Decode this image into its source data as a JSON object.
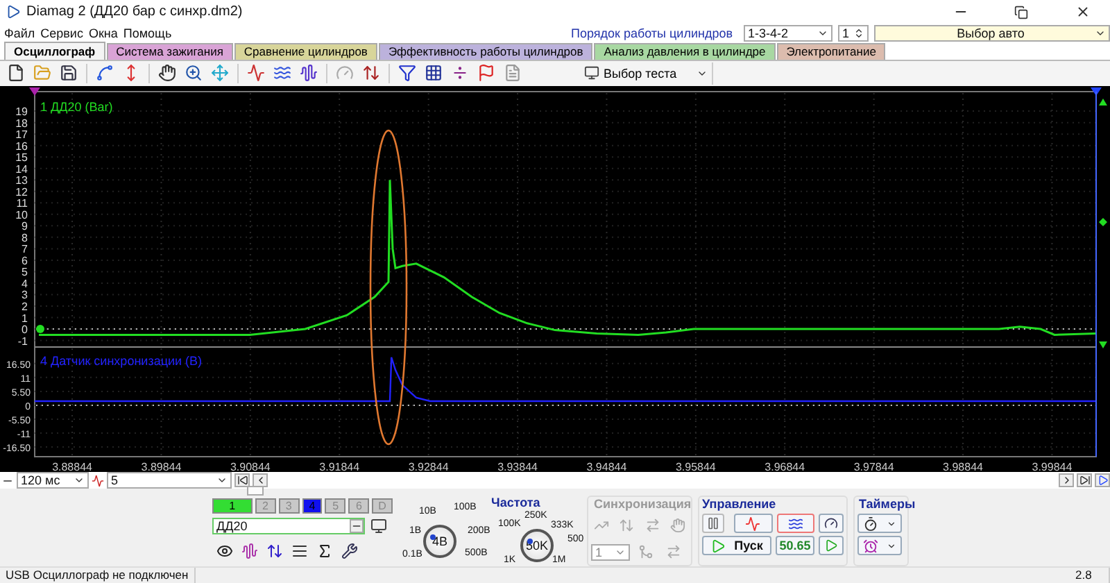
{
  "window": {
    "title": "Diamag 2 (ДД20 бар с синхр.dm2)"
  },
  "menu": [
    "Файл",
    "Сервис",
    "Окна",
    "Помощь"
  ],
  "cylinder_order": {
    "label": "Порядок работы цилиндров",
    "value": "1-3-4-2",
    "spinner": "1"
  },
  "car_select": {
    "value": "Выбор авто"
  },
  "tabs": [
    {
      "label": "Осциллограф",
      "selected": true,
      "color": "#f4f4f4"
    },
    {
      "label": "Система зажигания",
      "selected": false,
      "color": "#d9a3d6"
    },
    {
      "label": "Сравнение цилиндров",
      "selected": false,
      "color": "#d8d59a"
    },
    {
      "label": "Эффективность работы цилиндров",
      "selected": false,
      "color": "#bcb2dc"
    },
    {
      "label": "Анализ давления в цилиндре",
      "selected": false,
      "color": "#a8d8a2"
    },
    {
      "label": "Электропитание",
      "selected": false,
      "color": "#dcbcae"
    }
  ],
  "toolbar": {
    "test_select": "Выбор теста"
  },
  "scope": {
    "channels": [
      {
        "chart_data": {
          "type": "line",
          "grid": true,
          "xlim": [
            3.88423,
            4.00339
          ],
          "ylim": [
            -1.45,
            20.58
          ],
          "yticks": [
            19,
            18,
            17,
            16,
            15,
            14,
            13,
            12,
            11,
            10,
            9,
            8,
            7,
            6,
            5,
            4,
            3,
            2,
            1,
            0,
            -1
          ],
          "x": [
            3.8847,
            3.90838,
            3.91461,
            3.91928,
            3.9224,
            3.92395,
            3.92411,
            3.92442,
            3.92473,
            3.92551,
            3.92707,
            3.93018,
            3.9333,
            3.93641,
            3.93953,
            3.94264,
            3.94732,
            3.95199,
            3.95511,
            3.95822,
            3.99249,
            3.99482,
            3.99716,
            3.99872,
            4.00339
          ],
          "series": [
            {
              "name": "1 ДД20 (Bar)",
              "color": "#22dd22",
              "values": [
                -0.5,
                -0.5,
                0,
                1.2,
                2.8,
                4.1,
                13,
                7,
                5.3,
                5.5,
                5.7,
                4.5,
                2.8,
                1.4,
                0.5,
                -0.1,
                -0.4,
                -0.5,
                -0.3,
                0,
                0,
                0.2,
                0,
                -0.5,
                -0.4
              ]
            }
          ]
        }
      },
      {
        "chart_data": {
          "type": "line",
          "grid": true,
          "xlim": [
            3.88423,
            4.00339
          ],
          "ylim": [
            -19.8,
            22.5
          ],
          "yticks": [
            {
              "value": 16.5,
              "label": "16.50"
            },
            11,
            {
              "value": 5.5,
              "label": "5.50"
            },
            0,
            {
              "value": -5.5,
              "label": "-5.50"
            },
            -11,
            {
              "value": -16.5,
              "label": "-16.50"
            }
          ],
          "xticks": [
            3.88844,
            3.89844,
            3.90844,
            3.91844,
            3.92844,
            3.93844,
            3.94844,
            3.95844,
            3.96844,
            3.97844,
            3.98844,
            3.99844
          ],
          "x": [
            3.88423,
            3.92411,
            3.92427,
            3.92473,
            3.92551,
            3.92707,
            3.92863,
            4.00339
          ],
          "series": [
            {
              "name": "4 Датчик синхронизации (В)",
              "color": "#2222ff",
              "values": [
                1.6,
                1.6,
                19,
                14,
                8,
                3,
                1.6,
                1.6
              ]
            }
          ]
        }
      }
    ]
  },
  "timebase": {
    "value": "120 мс"
  },
  "averaging": {
    "value": "5"
  },
  "channel_buttons": [
    {
      "label": "1",
      "on": true,
      "color": "#33dd33"
    },
    {
      "label": "2",
      "on": false
    },
    {
      "label": "3",
      "on": false
    },
    {
      "label": "4",
      "on": true,
      "color": "#1010ee"
    },
    {
      "label": "5",
      "on": false
    },
    {
      "label": "6",
      "on": false
    },
    {
      "label": "D",
      "on": false
    }
  ],
  "channel_field": {
    "value": "ДД20"
  },
  "amplitude_knob": {
    "value": "4В",
    "labels": [
      "0.1В",
      "1В",
      "10В",
      "100В",
      "200В",
      "500В"
    ]
  },
  "frequency": {
    "title": "Частота",
    "value": "50K",
    "labels": [
      "1K",
      "100K",
      "250K",
      "333K",
      "500",
      "1M"
    ]
  },
  "sync": {
    "title": "Синхронизация",
    "disabled": true,
    "channel": "1"
  },
  "control": {
    "title": "Управление",
    "start": "Пуск",
    "reading": "50.65"
  },
  "timers": {
    "title": "Таймеры"
  },
  "status_bar": {
    "message": "USB Осциллограф не подключен",
    "version": "2.8"
  }
}
